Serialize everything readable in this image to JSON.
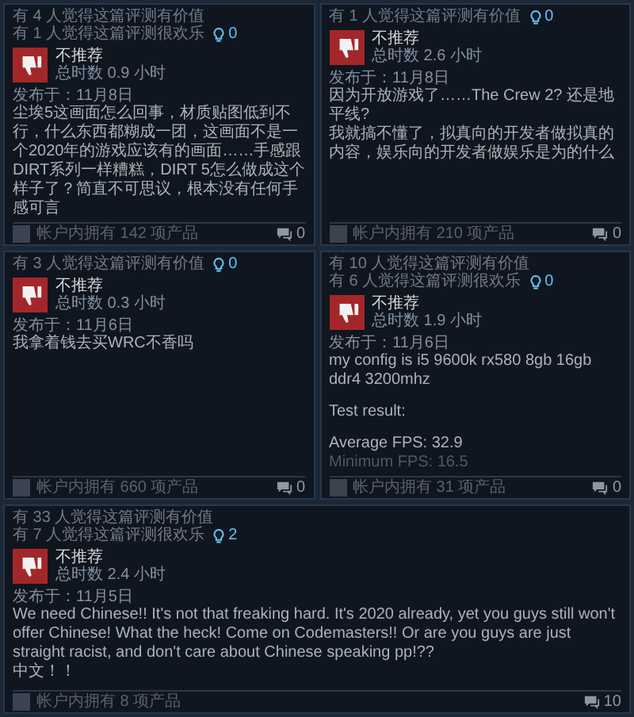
{
  "reviews": [
    {
      "helpful": [
        "有 4 人觉得这篇评测有价值",
        "有 1 人觉得这篇评测很欢乐"
      ],
      "awards": "0",
      "verdict": "不推荐",
      "hours": "总时数 0.9 小时",
      "date": "发布于：11月8日",
      "body": [
        {
          "text": "尘埃5这画面怎么回事，材质贴图低到不行，什么东西都糊成一团，这画面不是一个2020年的游戏应该有的画面……手感跟DIRT系列一样糟糕，DIRT 5怎么做成这个样子了？简直不可思议，根本没有任何手感可言"
        }
      ],
      "faded": false,
      "products": "帐户内拥有 142 项产品",
      "comments": "0"
    },
    {
      "helpful": [
        "有 1 人觉得这篇评测有价值"
      ],
      "awards": "0",
      "verdict": "不推荐",
      "hours": "总时数 2.6 小时",
      "date": "发布于：11月8日",
      "body": [
        {
          "text": "因为开放游戏了……The Crew 2? 还是地平线?"
        },
        {
          "text": "我就搞不懂了，拟真向的开发者做拟真的内容，娱乐向的开发者做娱乐是为的什么"
        }
      ],
      "faded": false,
      "products": "帐户内拥有 210 项产品",
      "comments": "0"
    },
    {
      "helpful": [
        "有 3 人觉得这篇评测有价值"
      ],
      "awards": "0",
      "verdict": "不推荐",
      "hours": "总时数 0.3 小时",
      "date": "发布于：11月6日",
      "body": [
        {
          "text": "我拿着钱去买WRC不香吗"
        }
      ],
      "faded": false,
      "products": "帐户内拥有 660 项产品",
      "comments": "0"
    },
    {
      "helpful": [
        "有 10 人觉得这篇评测有价值",
        "有 6 人觉得这篇评测很欢乐"
      ],
      "awards": "0",
      "verdict": "不推荐",
      "hours": "总时数 1.9 小时",
      "date": "发布于：11月6日",
      "body": [
        {
          "text": "my config is i5 9600k rx580 8gb 16gb ddr4 3200mhz"
        },
        {
          "text": "Test result:",
          "gap": true
        },
        {
          "text": "Average FPS: 32.9",
          "gap": true
        },
        {
          "text": "Minimum FPS: 16.5"
        }
      ],
      "faded": true,
      "products": "帐户内拥有 31 项产品",
      "comments": "0"
    },
    {
      "helpful": [
        "有 33 人觉得这篇评测有价值",
        "有 7 人觉得这篇评测很欢乐"
      ],
      "awards": "2",
      "verdict": "不推荐",
      "hours": "总时数 2.4 小时",
      "date": "发布于：11月5日",
      "body": [
        {
          "text": "We need Chinese!! It's not that freaking hard. It's 2020 already, yet you guys still won't offer Chinese! What the heck! Come on Codemasters!! Or are you guys are just straight racist, and don't care about Chinese speaking pp!??"
        },
        {
          "text": "中文！！"
        }
      ],
      "faded": false,
      "products": "帐户内拥有 8 项产品",
      "comments": "10"
    }
  ]
}
